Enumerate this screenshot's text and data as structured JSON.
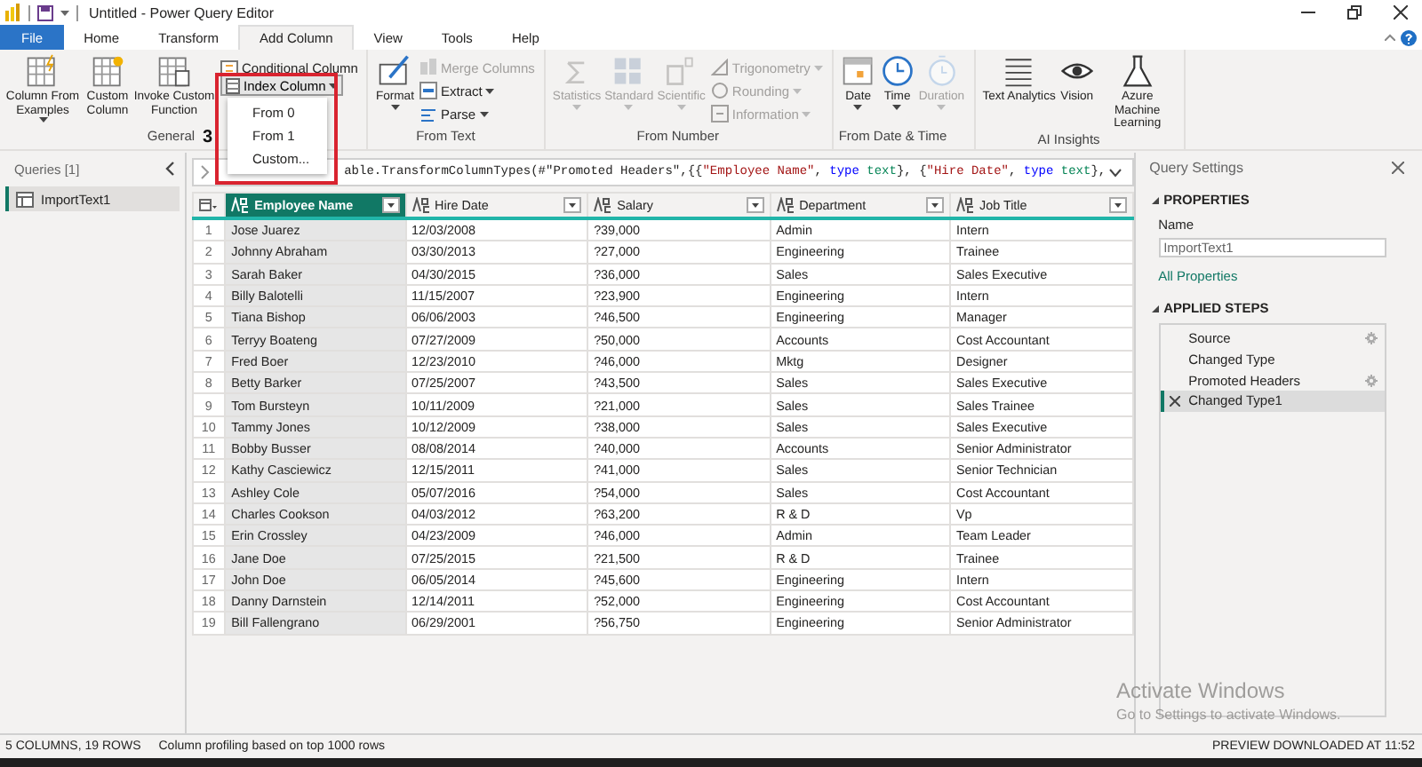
{
  "window": {
    "title": "Untitled - Power Query Editor"
  },
  "menu_tabs": [
    {
      "label": "File",
      "kind": "file",
      "selected": false
    },
    {
      "label": "Home",
      "kind": "tab",
      "selected": false
    },
    {
      "label": "Transform",
      "kind": "tab",
      "selected": false
    },
    {
      "label": "Add Column",
      "kind": "tab",
      "selected": true
    },
    {
      "label": "View",
      "kind": "tab",
      "selected": false
    },
    {
      "label": "Tools",
      "kind": "tab",
      "selected": false
    },
    {
      "label": "Help",
      "kind": "tab",
      "selected": false
    }
  ],
  "ribbon_groups": [
    {
      "label": "General",
      "items": [
        {
          "kind": "large",
          "label": "Column From Examples",
          "caret": true,
          "disabled": false
        },
        {
          "kind": "large",
          "label": "Custom Column",
          "caret": false,
          "disabled": false
        },
        {
          "kind": "large",
          "label": "Invoke Custom Function",
          "caret": false,
          "disabled": false
        },
        {
          "kind": "stack",
          "items": [
            {
              "label": "Conditional Column",
              "caret": false,
              "disabled": false
            }
          ]
        }
      ]
    },
    {
      "label": "From Text",
      "items": [
        {
          "kind": "large",
          "label": "Format",
          "caret": true,
          "disabled": false
        },
        {
          "kind": "stack",
          "items": [
            {
              "label": "Merge Columns",
              "caret": false,
              "disabled": true
            },
            {
              "label": "Extract",
              "caret": true,
              "disabled": false
            },
            {
              "label": "Parse",
              "caret": true,
              "disabled": false
            }
          ]
        }
      ]
    },
    {
      "label": "From Number",
      "items": [
        {
          "kind": "large",
          "label": "Statistics",
          "caret": true,
          "disabled": true
        },
        {
          "kind": "large",
          "label": "Standard",
          "caret": true,
          "disabled": true
        },
        {
          "kind": "large",
          "label": "Scientific",
          "caret": true,
          "disabled": true
        },
        {
          "kind": "stack",
          "items": [
            {
              "label": "Trigonometry",
              "caret": true,
              "disabled": true
            },
            {
              "label": "Rounding",
              "caret": true,
              "disabled": true
            },
            {
              "label": "Information",
              "caret": true,
              "disabled": true
            }
          ]
        }
      ]
    },
    {
      "label": "From Date & Time",
      "items": [
        {
          "kind": "large",
          "label": "Date",
          "caret": true,
          "disabled": false
        },
        {
          "kind": "large",
          "label": "Time",
          "caret": true,
          "disabled": false
        },
        {
          "kind": "large",
          "label": "Duration",
          "caret": true,
          "disabled": true
        }
      ]
    },
    {
      "label": "AI Insights",
      "items": [
        {
          "kind": "large",
          "label": "Text Analytics",
          "caret": false,
          "disabled": false
        },
        {
          "kind": "large",
          "label": "Vision",
          "caret": false,
          "disabled": false
        },
        {
          "kind": "large",
          "label": "Azure Machine Learning",
          "caret": false,
          "disabled": false
        }
      ]
    }
  ],
  "index_dropdown": {
    "label": "Index Column",
    "items": [
      {
        "label": "From 0"
      },
      {
        "label": "From 1"
      },
      {
        "label": "Custom..."
      }
    ]
  },
  "annotation": "3",
  "queries": {
    "title": "Queries [1]",
    "items": [
      {
        "label": "ImportText1",
        "selected": true
      }
    ]
  },
  "formula": [
    {
      "kind": "plain",
      "text": "able.TransformColumnTypes(#\"Promoted Headers\",{{"
    },
    {
      "kind": "string",
      "text": "\"Employee Name\""
    },
    {
      "kind": "plain",
      "text": ", "
    },
    {
      "kind": "keyword",
      "text": "type"
    },
    {
      "kind": "type",
      "text": "text"
    },
    {
      "kind": "plain",
      "text": "}, {"
    },
    {
      "kind": "string",
      "text": "\"Hire Date\""
    },
    {
      "kind": "plain",
      "text": ", "
    },
    {
      "kind": "keyword",
      "text": "type"
    },
    {
      "kind": "type",
      "text": "text"
    },
    {
      "kind": "plain",
      "text": "},"
    }
  ],
  "table": {
    "columns": [
      {
        "label": "Employee Name",
        "selected": true
      },
      {
        "label": "Hire Date",
        "selected": false
      },
      {
        "label": "Salary",
        "selected": false
      },
      {
        "label": "Department",
        "selected": false
      },
      {
        "label": "Job Title",
        "selected": false
      }
    ],
    "rows": [
      {
        "number": "1",
        "cells": [
          "Jose Juarez",
          "12/03/2008",
          "?39,000",
          "Admin",
          "Intern"
        ]
      },
      {
        "number": "2",
        "cells": [
          "Johnny Abraham",
          "03/30/2013",
          "?27,000",
          "Engineering",
          "Trainee"
        ]
      },
      {
        "number": "3",
        "cells": [
          "Sarah Baker",
          "04/30/2015",
          "?36,000",
          "Sales",
          "Sales Executive"
        ]
      },
      {
        "number": "4",
        "cells": [
          "Billy Balotelli",
          "11/15/2007",
          "?23,900",
          "Engineering",
          "Intern"
        ]
      },
      {
        "number": "5",
        "cells": [
          "Tiana Bishop",
          "06/06/2003",
          "?46,500",
          "Engineering",
          "Manager"
        ]
      },
      {
        "number": "6",
        "cells": [
          "Terryy Boateng",
          "07/27/2009",
          "?50,000",
          "Accounts",
          "Cost Accountant"
        ]
      },
      {
        "number": "7",
        "cells": [
          "Fred Boer",
          "12/23/2010",
          "?46,000",
          "Mktg",
          "Designer"
        ]
      },
      {
        "number": "8",
        "cells": [
          "Betty Barker",
          "07/25/2007",
          "?43,500",
          "Sales",
          "Sales Executive"
        ]
      },
      {
        "number": "9",
        "cells": [
          "Tom Bursteyn",
          "10/11/2009",
          "?21,000",
          "Sales",
          "Sales Trainee"
        ]
      },
      {
        "number": "10",
        "cells": [
          "Tammy Jones",
          "10/12/2009",
          "?38,000",
          "Sales",
          "Sales Executive"
        ]
      },
      {
        "number": "11",
        "cells": [
          "Bobby Busser",
          "08/08/2014",
          "?40,000",
          "Accounts",
          "Senior Administrator"
        ]
      },
      {
        "number": "12",
        "cells": [
          "Kathy Casciewicz",
          "12/15/2011",
          "?41,000",
          "Sales",
          "Senior Technician"
        ]
      },
      {
        "number": "13",
        "cells": [
          "Ashley Cole",
          "05/07/2016",
          "?54,000",
          "Sales",
          "Cost Accountant"
        ]
      },
      {
        "number": "14",
        "cells": [
          "Charles Cookson",
          "04/03/2012",
          "?63,200",
          "R & D",
          "Vp"
        ]
      },
      {
        "number": "15",
        "cells": [
          "Erin Crossley",
          "04/23/2009",
          "?46,000",
          "Admin",
          "Team Leader"
        ]
      },
      {
        "number": "16",
        "cells": [
          "Jane Doe",
          "07/25/2015",
          "?21,500",
          "R & D",
          "Trainee"
        ]
      },
      {
        "number": "17",
        "cells": [
          "John Doe",
          "06/05/2014",
          "?45,600",
          "Engineering",
          "Intern"
        ]
      },
      {
        "number": "18",
        "cells": [
          "Danny Darnstein",
          "12/14/2011",
          "?52,000",
          "Engineering",
          "Cost Accountant"
        ]
      },
      {
        "number": "19",
        "cells": [
          "Bill Fallengrano",
          "06/29/2001",
          "?56,750",
          "Engineering",
          "Senior Administrator"
        ]
      }
    ]
  },
  "query_settings": {
    "title": "Query Settings",
    "properties_heading": "PROPERTIES",
    "name_label": "Name",
    "name_value": "ImportText1",
    "all_properties": "All Properties",
    "steps_heading": "APPLIED STEPS",
    "steps": [
      {
        "label": "Source",
        "settings": true,
        "selected": false
      },
      {
        "label": "Changed Type",
        "settings": false,
        "selected": false
      },
      {
        "label": "Promoted Headers",
        "settings": true,
        "selected": false
      },
      {
        "label": "Changed Type1",
        "settings": false,
        "selected": true
      }
    ]
  },
  "status_bar": {
    "summary": "5 COLUMNS, 19 ROWS",
    "profiling": "Column profiling based on top 1000 rows",
    "preview": "PREVIEW DOWNLOADED AT 11:52"
  },
  "os_notice": {
    "title": "Activate Windows",
    "text": "Go to Settings to activate Windows."
  }
}
